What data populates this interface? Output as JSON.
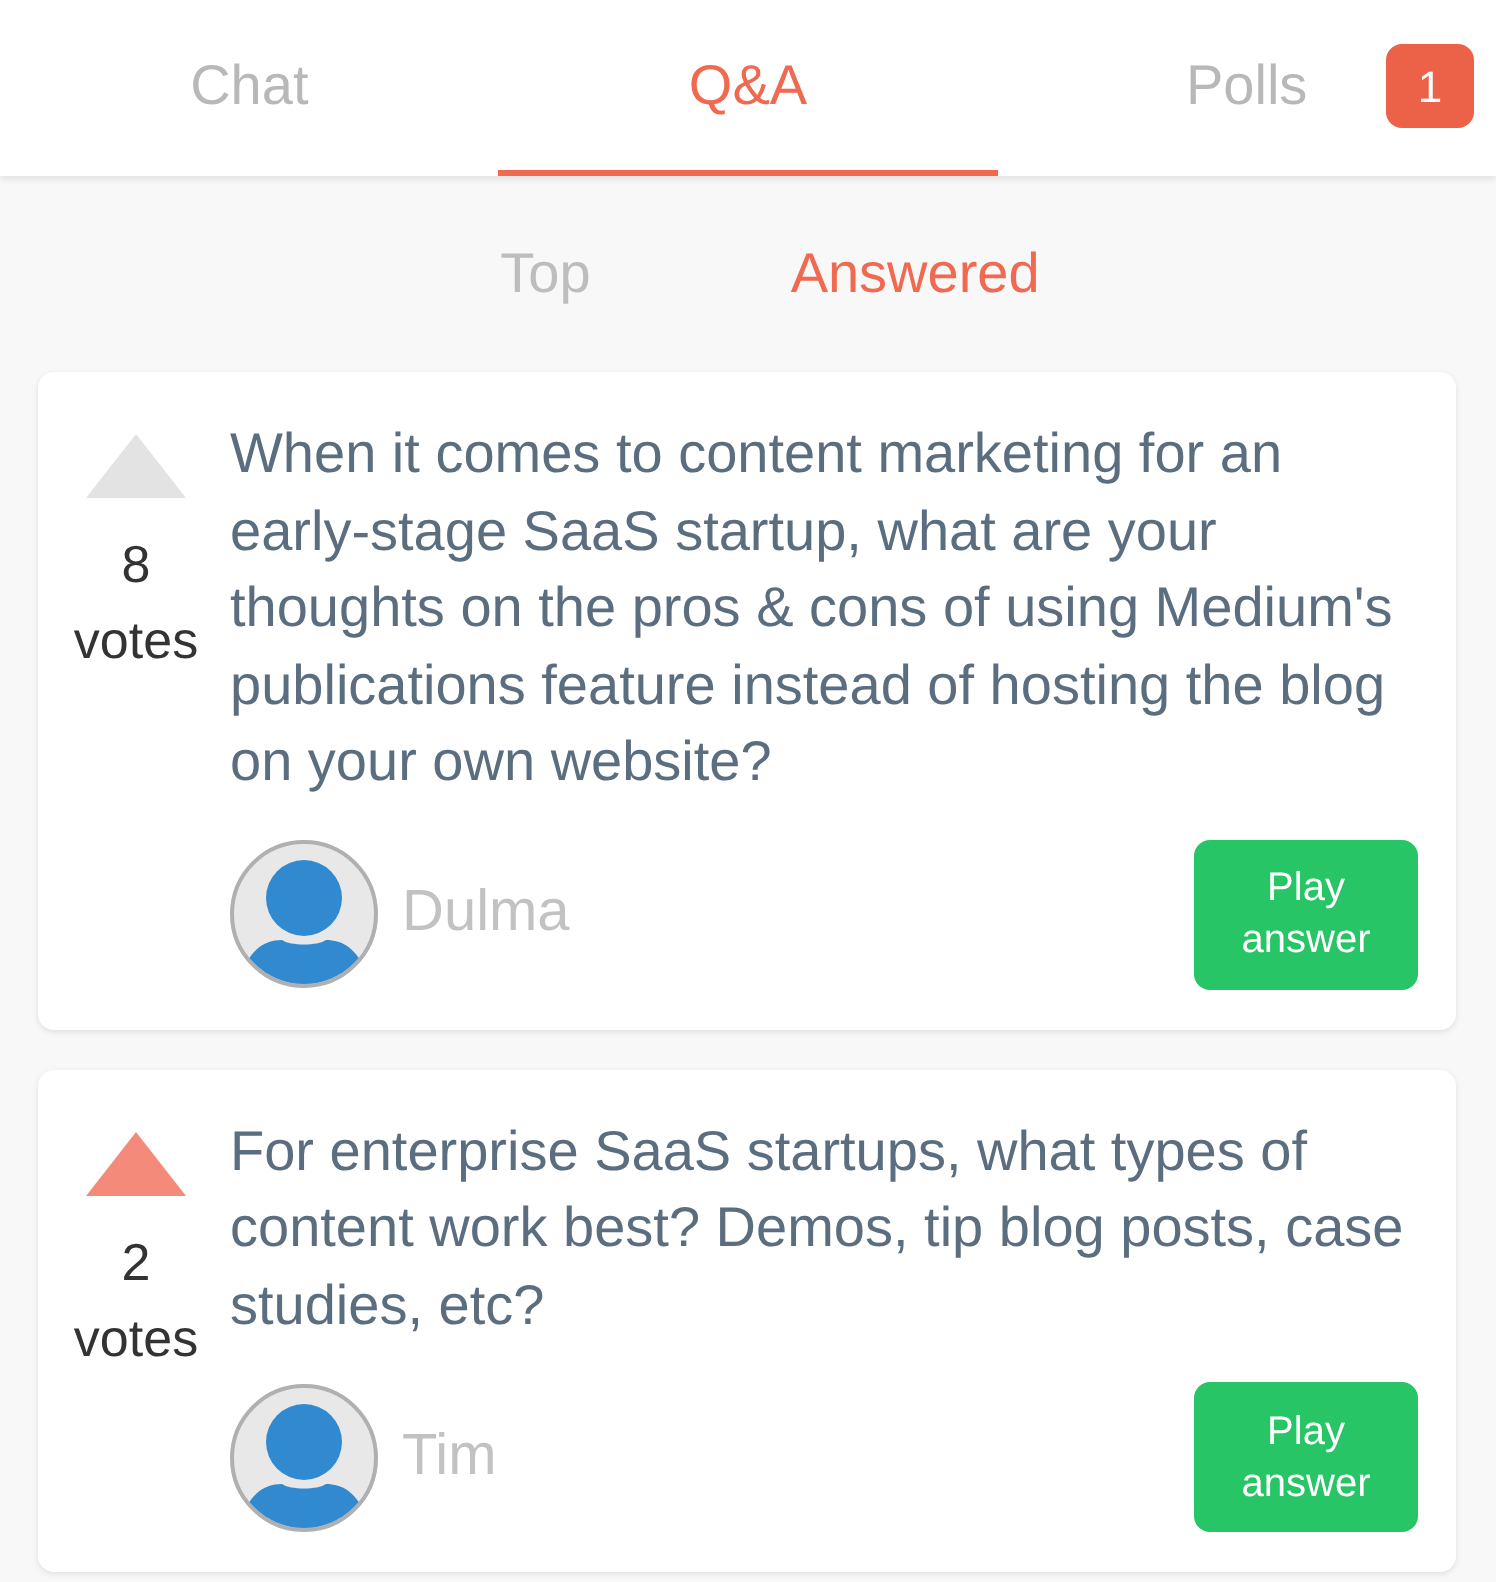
{
  "tabs": [
    {
      "label": "Chat",
      "selected": false
    },
    {
      "label": "Q&A",
      "selected": true
    },
    {
      "label": "Polls",
      "selected": false,
      "badge": "1"
    }
  ],
  "filters": [
    {
      "label": "Top",
      "selected": false
    },
    {
      "label": "Answered",
      "selected": true
    }
  ],
  "questions": [
    {
      "upvoted": false,
      "votes": "8",
      "votes_label": "votes",
      "text": "When it comes to content marketing for an early-stage SaaS startup, what are your thoughts on the pros & cons of using Medium's publications feature instead of hosting the blog on your own website?",
      "author": "Dulma",
      "action": "Play answer"
    },
    {
      "upvoted": true,
      "votes": "2",
      "votes_label": "votes",
      "text": "For enterprise SaaS startups, what types of content work best? Demos, tip blog posts, case studies, etc?",
      "author": "Tim",
      "action": "Play answer"
    }
  ]
}
